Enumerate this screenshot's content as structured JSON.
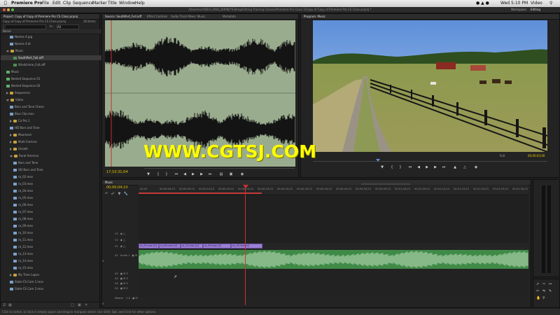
{
  "menubar": {
    "apple": "",
    "app_name": "Premiere Pro",
    "items": [
      "File",
      "Edit",
      "Clip",
      "Sequence",
      "Marker",
      "Title",
      "Window",
      "Help"
    ],
    "clock": "Wed 5:10 PM",
    "right_extra": "Video"
  },
  "window_title": "/Volumes/VIDEO_RAID_BOMB/*Editing/Editing Training Classes/Premiere Pro Class 1/Copy of Copy of Premiere Pro CS Class.prproj *",
  "workspace": {
    "label": "Workspace",
    "value": "Editing"
  },
  "project": {
    "tabs": [
      "Project: Copy of Copy of Premiere Pro CS Class.prproj",
      "Media Browser",
      "Info"
    ],
    "file_name": "Copy of Copy of Premiere Pro CS Class.prproj",
    "items_count": "28 Items",
    "in_label": "In:",
    "in_value": "All",
    "name_header": "Name",
    "rows": [
      {
        "label": "Names 4.jpg",
        "icon": "clip",
        "indent": 2
      },
      {
        "label": "Names 4.kt",
        "icon": "clip",
        "indent": 2
      },
      {
        "label": "Music",
        "icon": "folder",
        "indent": 1,
        "open": true
      },
      {
        "label": "SouthPort_Full.aiff",
        "icon": "aud",
        "indent": 3,
        "selected": true
      },
      {
        "label": "Windchime_Full.aiff",
        "icon": "aud",
        "indent": 3
      },
      {
        "label": "Music",
        "icon": "seq",
        "indent": 1
      },
      {
        "label": "Nested Sequence 01",
        "icon": "seq",
        "indent": 1
      },
      {
        "label": "Nested Sequence 02",
        "icon": "seq",
        "indent": 1
      },
      {
        "label": "Sequences",
        "icon": "folder",
        "indent": 1,
        "closed": true
      },
      {
        "label": "Video",
        "icon": "folder",
        "indent": 1,
        "open": true
      },
      {
        "label": "Bars and Tone Chesn",
        "icon": "clip",
        "indent": 2
      },
      {
        "label": "Blue Clip.mov",
        "icon": "clip",
        "indent": 2
      },
      {
        "label": "Ca Pro 1",
        "icon": "folder",
        "indent": 2,
        "closed": true
      },
      {
        "label": "HD Bars and Tone",
        "icon": "clip",
        "indent": 2
      },
      {
        "label": "Moorland",
        "icon": "folder",
        "indent": 2,
        "closed": true
      },
      {
        "label": "Multi Camera",
        "icon": "folder",
        "indent": 2,
        "closed": true
      },
      {
        "label": "Unsafe",
        "icon": "folder",
        "indent": 2,
        "closed": true
      },
      {
        "label": "Rural America",
        "icon": "folder",
        "indent": 2,
        "open": true
      },
      {
        "label": "Bars and Tone",
        "icon": "clip",
        "indent": 3
      },
      {
        "label": "HD Bars and Tone",
        "icon": "clip",
        "indent": 3
      },
      {
        "label": "ra_02.mov",
        "icon": "clip",
        "indent": 3
      },
      {
        "label": "ra_03.mov",
        "icon": "clip",
        "indent": 3
      },
      {
        "label": "ra_04.mov",
        "icon": "clip",
        "indent": 3
      },
      {
        "label": "ra_05.mov",
        "icon": "clip",
        "indent": 3
      },
      {
        "label": "ra_06.mov",
        "icon": "clip",
        "indent": 3
      },
      {
        "label": "ra_07.mov",
        "icon": "clip",
        "indent": 3
      },
      {
        "label": "ra_08.mov",
        "icon": "clip",
        "indent": 3
      },
      {
        "label": "ra_09.mov",
        "icon": "clip",
        "indent": 3
      },
      {
        "label": "ra_10.mov",
        "icon": "clip",
        "indent": 3
      },
      {
        "label": "ra_11.mov",
        "icon": "clip",
        "indent": 3
      },
      {
        "label": "ra_12.mov",
        "icon": "clip",
        "indent": 3
      },
      {
        "label": "ra_13.mov",
        "icon": "clip",
        "indent": 3
      },
      {
        "label": "ra_14.mov",
        "icon": "clip",
        "indent": 3
      },
      {
        "label": "ra_15.mov",
        "icon": "clip",
        "indent": 3
      },
      {
        "label": "My Time Lapse",
        "icon": "folder",
        "indent": 2,
        "closed": true
      },
      {
        "label": "Slate-CS Cam 1.mov",
        "icon": "clip",
        "indent": 2
      },
      {
        "label": "Slate-CS Cam 2.mov",
        "icon": "clip",
        "indent": 2
      }
    ]
  },
  "source": {
    "tabs": [
      "Source: SouthPort_Full.aiff",
      "Effect Controls",
      "Audio Track Mixer: Music",
      "Metadata"
    ],
    "timecode": "17;10;31;04",
    "buttons": [
      "marker",
      "in",
      "out",
      "go-in",
      "step-back",
      "play",
      "step-fwd",
      "go-out",
      "insert",
      "overwrite",
      "export-frame"
    ]
  },
  "program": {
    "tabs": [
      "Program: Music"
    ],
    "fit": "Full",
    "timecode": "00;00;03;00",
    "buttons": [
      "marker",
      "in",
      "out",
      "go-in",
      "step-back",
      "play",
      "step-fwd",
      "go-out",
      "lift",
      "extract",
      "export-frame"
    ]
  },
  "timeline": {
    "tabs": [
      "Music"
    ],
    "timecode": "00;00;04;10",
    "ruler": [
      "00;00",
      "00;00;04;23",
      "00;00;09;23",
      "00;00;14;23",
      "00;00;19;23",
      "00;00;24;23",
      "00;00;29;23",
      "00;00;34;23",
      "00;00;39;23",
      "00;00;44;23",
      "00;00;49;23",
      "00;00;54;23",
      "00;00;59;23",
      "00;01;04;23",
      "00;01;09;23",
      "00;01;14;23",
      "00;01;19;23",
      "00;01;24;23",
      "00;01;29;23",
      "00;01;34;23"
    ],
    "tracks": [
      {
        "name": "V3",
        "type": "video"
      },
      {
        "name": "V2",
        "type": "video"
      },
      {
        "name": "V1",
        "type": "video"
      },
      {
        "name": "A1",
        "label": "Audio 1",
        "type": "audio"
      },
      {
        "name": "A2",
        "type": "audio"
      },
      {
        "name": "A3",
        "type": "audio"
      },
      {
        "name": "A4",
        "type": "audio"
      },
      {
        "name": "A5",
        "type": "audio"
      },
      {
        "name": "Master",
        "value": "0.0",
        "type": "master"
      }
    ],
    "clips": [
      "ra_03.mov [V]",
      "ra_09.mov [V]",
      "ra_12.mov [V]",
      "ra_09.mov [V]",
      "ra_15.mov [V]"
    ]
  },
  "watermark": "WWW.CGTSJ.COM",
  "status": "Click to select, or click in empty space and drag to marquee select. Use Shift, Opt, and Cmd for other options.",
  "colors": {
    "waveform_bg": "#9aac8e",
    "clip_purple": "#9b7fd4",
    "audio_green": "#3f8a47",
    "playhead": "#d23030",
    "timecode_yellow": "#e5c800"
  }
}
